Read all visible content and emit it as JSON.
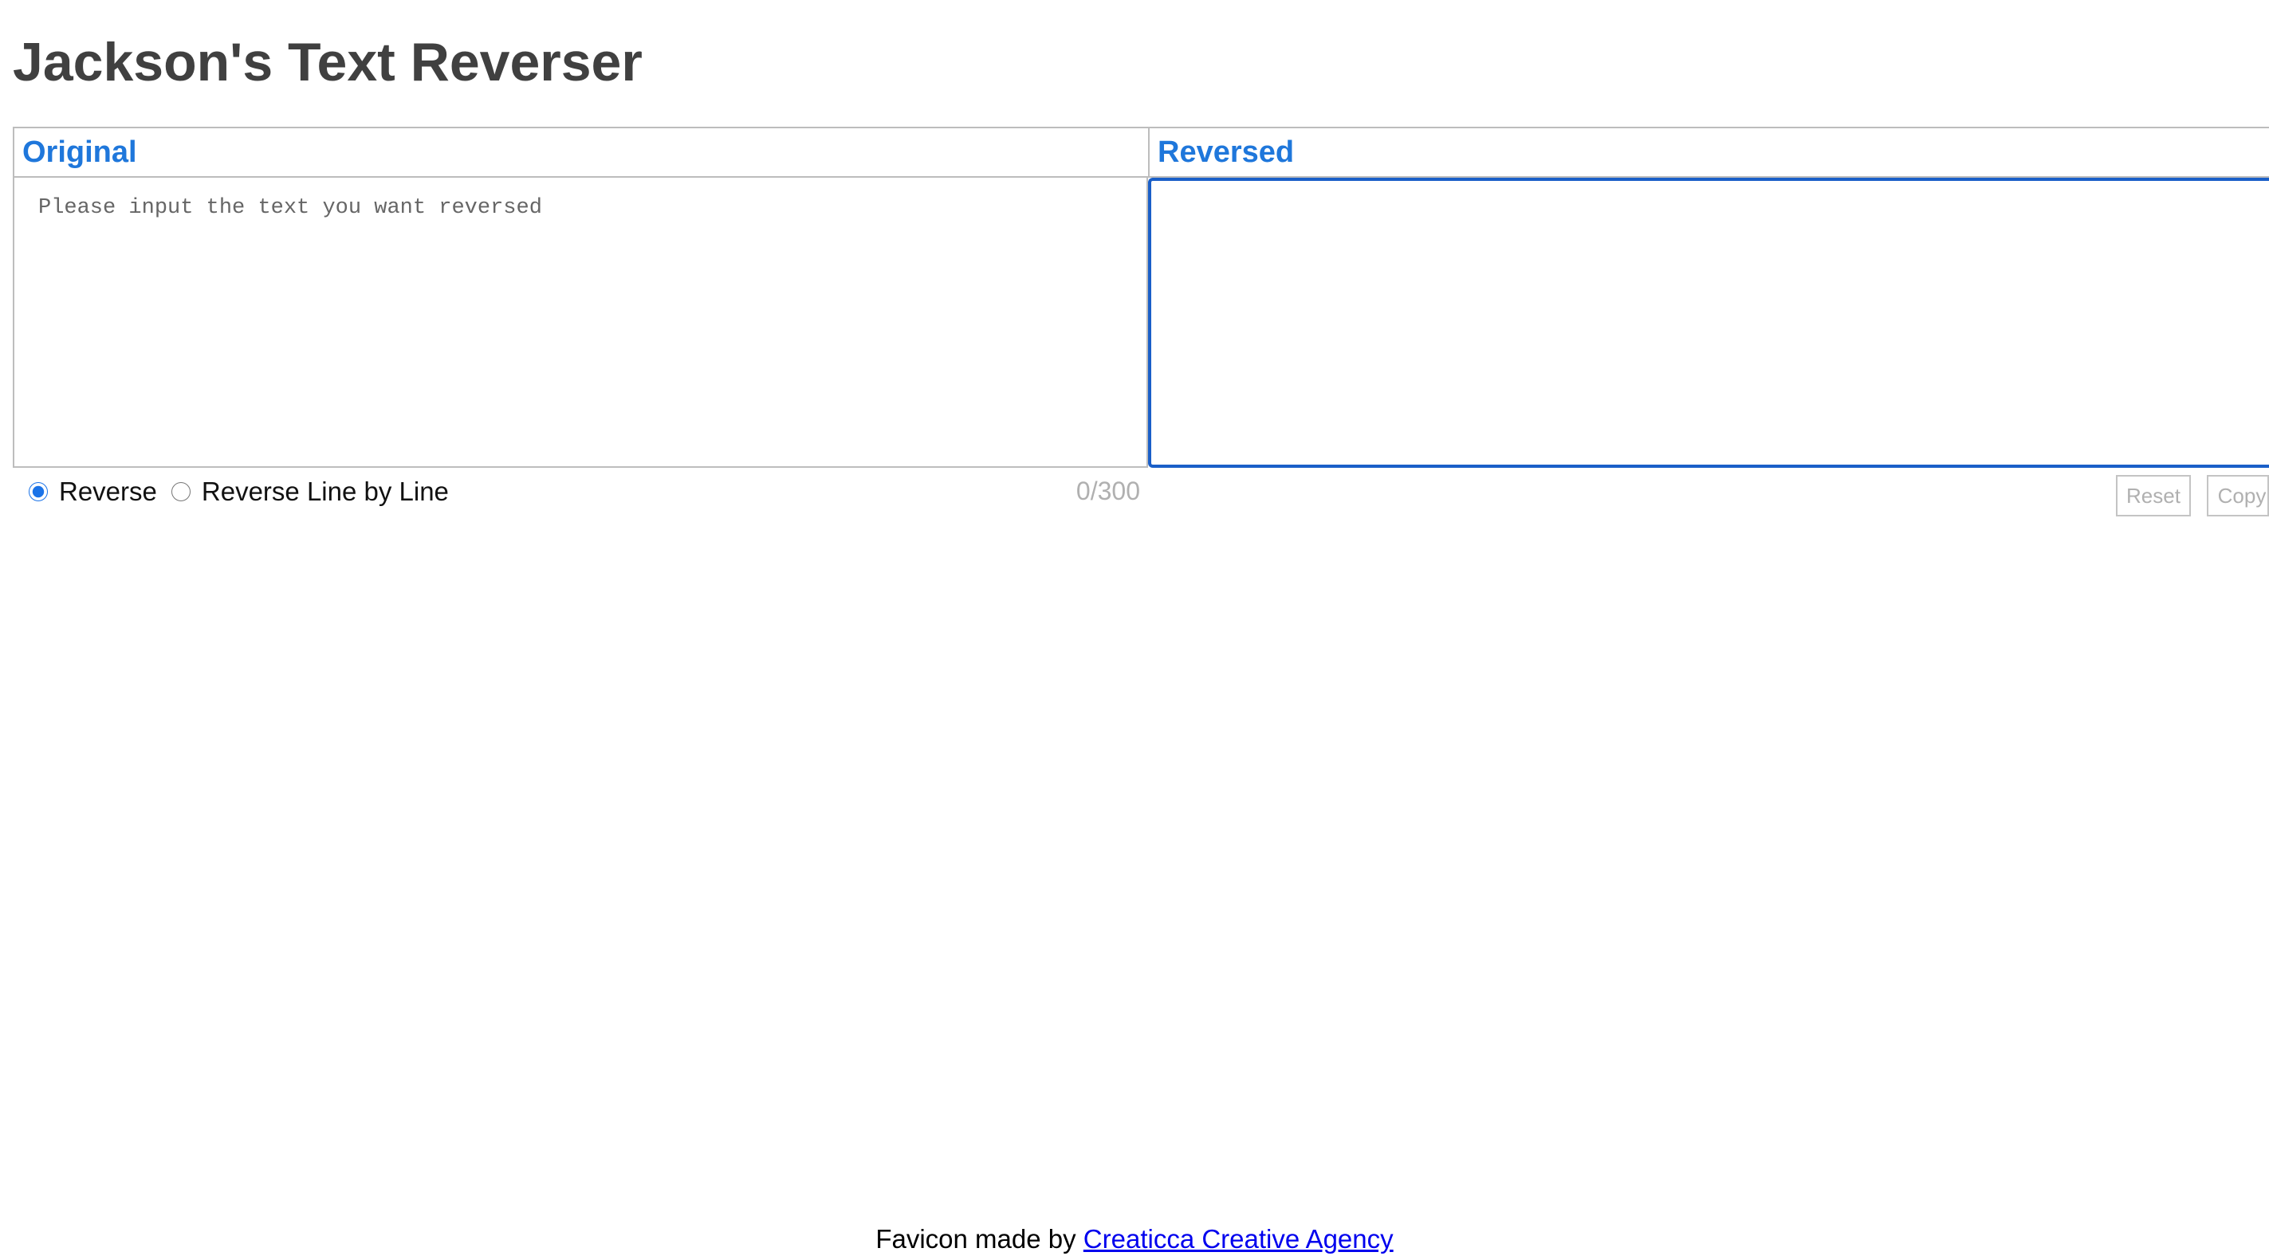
{
  "page": {
    "title": "Jackson's Text Reverser"
  },
  "original_panel": {
    "header": "Original",
    "placeholder": "Please input the text you want reversed",
    "value": ""
  },
  "reversed_panel": {
    "header": "Reversed",
    "value": ""
  },
  "mode": {
    "options": [
      {
        "label": "Reverse",
        "checked": true
      },
      {
        "label": "Reverse Line by Line",
        "checked": false
      }
    ]
  },
  "counter": {
    "text": "0/300"
  },
  "actions": {
    "reset_label": "Reset",
    "copy_label": "Copy"
  },
  "footer": {
    "prefix": "Favicon made by",
    "link_text": "Creaticca Creative Agency"
  },
  "colors": {
    "accent": "#1f77db",
    "focus_border": "#1a5fc8",
    "title": "#404040",
    "muted": "#b0b0b0"
  }
}
